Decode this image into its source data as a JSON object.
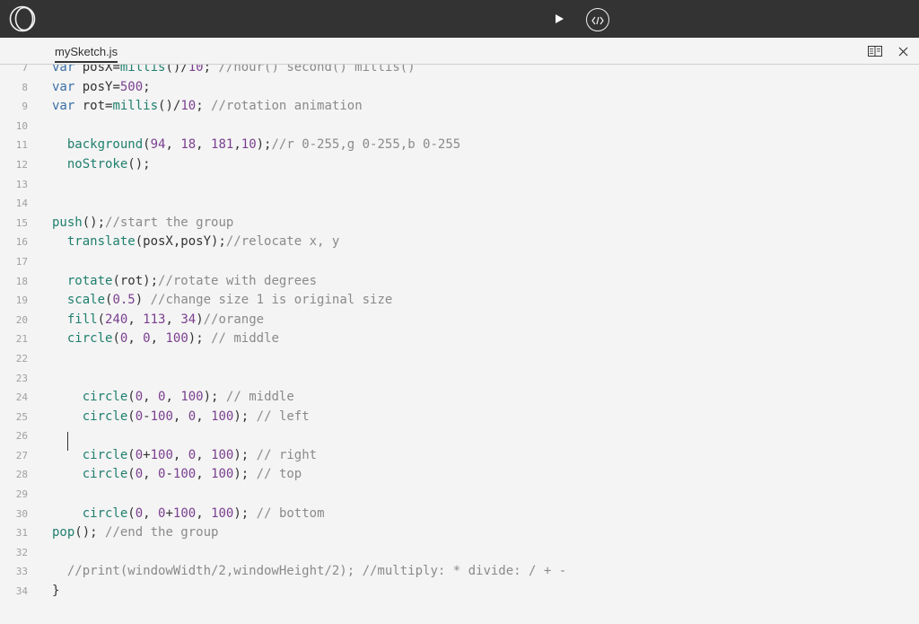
{
  "colors": {
    "topbar": "#333333",
    "keyword": "#3b6ea5",
    "function": "#1f7f6e",
    "number": "#7a3f8f",
    "comment": "#8a8a8a",
    "text": "#333333"
  },
  "toolbar": {
    "logo_icon": "p5-logo-icon",
    "run_icon": "play-icon",
    "embed_icon": "code-brackets-icon"
  },
  "tabs": [
    {
      "label": "mySketch.js",
      "active": true
    }
  ],
  "tab_actions": {
    "layout_icon": "split-view-icon",
    "close_icon": "close-icon"
  },
  "editor": {
    "lines": [
      {
        "num": "7",
        "tokens": [
          {
            "t": "var",
            "k": "keyword"
          },
          {
            "t": " posX=",
            "k": "text"
          },
          {
            "t": "millis",
            "k": "function"
          },
          {
            "t": "()/",
            "k": "text"
          },
          {
            "t": "10",
            "k": "number"
          },
          {
            "t": "; ",
            "k": "text"
          },
          {
            "t": "//hour() second() millis()",
            "k": "comment"
          }
        ]
      },
      {
        "num": "8",
        "tokens": [
          {
            "t": "var",
            "k": "keyword"
          },
          {
            "t": " posY=",
            "k": "text"
          },
          {
            "t": "500",
            "k": "number"
          },
          {
            "t": ";",
            "k": "text"
          }
        ]
      },
      {
        "num": "9",
        "tokens": [
          {
            "t": "var",
            "k": "keyword"
          },
          {
            "t": " rot=",
            "k": "text"
          },
          {
            "t": "millis",
            "k": "function"
          },
          {
            "t": "()/",
            "k": "text"
          },
          {
            "t": "10",
            "k": "number"
          },
          {
            "t": "; ",
            "k": "text"
          },
          {
            "t": "//rotation animation",
            "k": "comment"
          }
        ]
      },
      {
        "num": "10",
        "tokens": []
      },
      {
        "num": "11",
        "tokens": [
          {
            "t": "  ",
            "k": "text"
          },
          {
            "t": "background",
            "k": "function"
          },
          {
            "t": "(",
            "k": "text"
          },
          {
            "t": "94",
            "k": "number"
          },
          {
            "t": ", ",
            "k": "text"
          },
          {
            "t": "18",
            "k": "number"
          },
          {
            "t": ", ",
            "k": "text"
          },
          {
            "t": "181",
            "k": "number"
          },
          {
            "t": ",",
            "k": "text"
          },
          {
            "t": "10",
            "k": "number"
          },
          {
            "t": ");",
            "k": "text"
          },
          {
            "t": "//r 0-255,g 0-255,b 0-255",
            "k": "comment"
          }
        ]
      },
      {
        "num": "12",
        "tokens": [
          {
            "t": "  ",
            "k": "text"
          },
          {
            "t": "noStroke",
            "k": "function"
          },
          {
            "t": "();",
            "k": "text"
          }
        ]
      },
      {
        "num": "13",
        "tokens": []
      },
      {
        "num": "14",
        "tokens": []
      },
      {
        "num": "15",
        "tokens": [
          {
            "t": "push",
            "k": "function"
          },
          {
            "t": "();",
            "k": "text"
          },
          {
            "t": "//start the group",
            "k": "comment"
          }
        ]
      },
      {
        "num": "16",
        "tokens": [
          {
            "t": "  ",
            "k": "text"
          },
          {
            "t": "translate",
            "k": "function"
          },
          {
            "t": "(posX,posY);",
            "k": "text"
          },
          {
            "t": "//relocate x, y",
            "k": "comment"
          }
        ]
      },
      {
        "num": "17",
        "tokens": []
      },
      {
        "num": "18",
        "tokens": [
          {
            "t": "  ",
            "k": "text"
          },
          {
            "t": "rotate",
            "k": "function"
          },
          {
            "t": "(rot);",
            "k": "text"
          },
          {
            "t": "//rotate with degrees",
            "k": "comment"
          }
        ]
      },
      {
        "num": "19",
        "tokens": [
          {
            "t": "  ",
            "k": "text"
          },
          {
            "t": "scale",
            "k": "function"
          },
          {
            "t": "(",
            "k": "text"
          },
          {
            "t": "0.5",
            "k": "number"
          },
          {
            "t": ") ",
            "k": "text"
          },
          {
            "t": "//change size 1 is original size",
            "k": "comment"
          }
        ]
      },
      {
        "num": "20",
        "tokens": [
          {
            "t": "  ",
            "k": "text"
          },
          {
            "t": "fill",
            "k": "function"
          },
          {
            "t": "(",
            "k": "text"
          },
          {
            "t": "240",
            "k": "number"
          },
          {
            "t": ", ",
            "k": "text"
          },
          {
            "t": "113",
            "k": "number"
          },
          {
            "t": ", ",
            "k": "text"
          },
          {
            "t": "34",
            "k": "number"
          },
          {
            "t": ")",
            "k": "text"
          },
          {
            "t": "//orange",
            "k": "comment"
          }
        ]
      },
      {
        "num": "21",
        "tokens": [
          {
            "t": "  ",
            "k": "text"
          },
          {
            "t": "circle",
            "k": "function"
          },
          {
            "t": "(",
            "k": "text"
          },
          {
            "t": "0",
            "k": "number"
          },
          {
            "t": ", ",
            "k": "text"
          },
          {
            "t": "0",
            "k": "number"
          },
          {
            "t": ", ",
            "k": "text"
          },
          {
            "t": "100",
            "k": "number"
          },
          {
            "t": "); ",
            "k": "text"
          },
          {
            "t": "// middle",
            "k": "comment"
          }
        ]
      },
      {
        "num": "22",
        "tokens": []
      },
      {
        "num": "23",
        "tokens": []
      },
      {
        "num": "24",
        "tokens": [
          {
            "t": "    ",
            "k": "text"
          },
          {
            "t": "circle",
            "k": "function"
          },
          {
            "t": "(",
            "k": "text"
          },
          {
            "t": "0",
            "k": "number"
          },
          {
            "t": ", ",
            "k": "text"
          },
          {
            "t": "0",
            "k": "number"
          },
          {
            "t": ", ",
            "k": "text"
          },
          {
            "t": "100",
            "k": "number"
          },
          {
            "t": "); ",
            "k": "text"
          },
          {
            "t": "// middle",
            "k": "comment"
          }
        ]
      },
      {
        "num": "25",
        "tokens": [
          {
            "t": "    ",
            "k": "text"
          },
          {
            "t": "circle",
            "k": "function"
          },
          {
            "t": "(",
            "k": "text"
          },
          {
            "t": "0",
            "k": "number"
          },
          {
            "t": "-",
            "k": "text"
          },
          {
            "t": "100",
            "k": "number"
          },
          {
            "t": ", ",
            "k": "text"
          },
          {
            "t": "0",
            "k": "number"
          },
          {
            "t": ", ",
            "k": "text"
          },
          {
            "t": "100",
            "k": "number"
          },
          {
            "t": "); ",
            "k": "text"
          },
          {
            "t": "// left",
            "k": "comment"
          }
        ]
      },
      {
        "num": "26",
        "tokens": []
      },
      {
        "num": "27",
        "tokens": [
          {
            "t": "    ",
            "k": "text"
          },
          {
            "t": "circle",
            "k": "function"
          },
          {
            "t": "(",
            "k": "text"
          },
          {
            "t": "0",
            "k": "number"
          },
          {
            "t": "+",
            "k": "text"
          },
          {
            "t": "100",
            "k": "number"
          },
          {
            "t": ", ",
            "k": "text"
          },
          {
            "t": "0",
            "k": "number"
          },
          {
            "t": ", ",
            "k": "text"
          },
          {
            "t": "100",
            "k": "number"
          },
          {
            "t": "); ",
            "k": "text"
          },
          {
            "t": "// right",
            "k": "comment"
          }
        ]
      },
      {
        "num": "28",
        "tokens": [
          {
            "t": "    ",
            "k": "text"
          },
          {
            "t": "circle",
            "k": "function"
          },
          {
            "t": "(",
            "k": "text"
          },
          {
            "t": "0",
            "k": "number"
          },
          {
            "t": ", ",
            "k": "text"
          },
          {
            "t": "0",
            "k": "number"
          },
          {
            "t": "-",
            "k": "text"
          },
          {
            "t": "100",
            "k": "number"
          },
          {
            "t": ", ",
            "k": "text"
          },
          {
            "t": "100",
            "k": "number"
          },
          {
            "t": "); ",
            "k": "text"
          },
          {
            "t": "// top",
            "k": "comment"
          }
        ]
      },
      {
        "num": "29",
        "tokens": []
      },
      {
        "num": "30",
        "tokens": [
          {
            "t": "    ",
            "k": "text"
          },
          {
            "t": "circle",
            "k": "function"
          },
          {
            "t": "(",
            "k": "text"
          },
          {
            "t": "0",
            "k": "number"
          },
          {
            "t": ", ",
            "k": "text"
          },
          {
            "t": "0",
            "k": "number"
          },
          {
            "t": "+",
            "k": "text"
          },
          {
            "t": "100",
            "k": "number"
          },
          {
            "t": ", ",
            "k": "text"
          },
          {
            "t": "100",
            "k": "number"
          },
          {
            "t": "); ",
            "k": "text"
          },
          {
            "t": "// bottom",
            "k": "comment"
          }
        ]
      },
      {
        "num": "31",
        "tokens": [
          {
            "t": "pop",
            "k": "function"
          },
          {
            "t": "(); ",
            "k": "text"
          },
          {
            "t": "//end the group",
            "k": "comment"
          }
        ]
      },
      {
        "num": "32",
        "tokens": []
      },
      {
        "num": "33",
        "tokens": [
          {
            "t": "  ",
            "k": "text"
          },
          {
            "t": "//print(windowWidth/2,windowHeight/2); //multiply: * divide: / + -",
            "k": "comment"
          }
        ]
      },
      {
        "num": "34",
        "tokens": [
          {
            "t": "}",
            "k": "text"
          }
        ]
      }
    ]
  }
}
